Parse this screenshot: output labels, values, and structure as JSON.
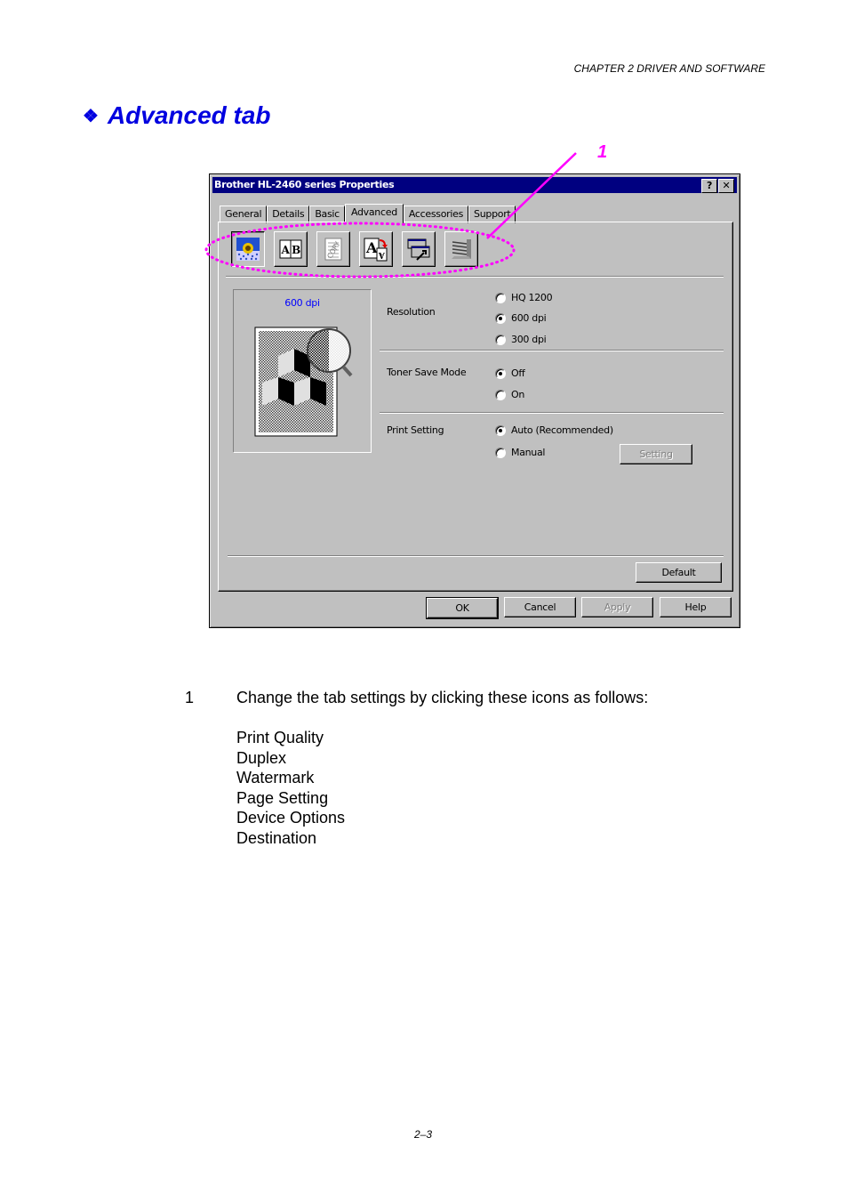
{
  "page": {
    "header": "CHAPTER 2 DRIVER AND SOFTWARE",
    "title_bullet": "❖",
    "title": "Advanced tab",
    "callout_label": "1",
    "footer": "2–3",
    "colors": {
      "title": "#0000e0",
      "callout": "#ff00ff",
      "titlebar": "#000080",
      "dialog_bg": "#c0c0c0"
    }
  },
  "dialog": {
    "title": "Brother HL-2460 series Properties",
    "help_button": "?",
    "close_button": "✕",
    "tabs": [
      {
        "label": "General",
        "active": false
      },
      {
        "label": "Details",
        "active": false
      },
      {
        "label": "Basic",
        "active": false
      },
      {
        "label": "Advanced",
        "active": true
      },
      {
        "label": "Accessories",
        "active": false
      },
      {
        "label": "Support",
        "active": false
      }
    ],
    "icons": [
      {
        "name": "print-quality-icon",
        "pressed": true
      },
      {
        "name": "duplex-icon",
        "pressed": false
      },
      {
        "name": "watermark-icon",
        "pressed": false
      },
      {
        "name": "page-setting-icon",
        "pressed": false
      },
      {
        "name": "device-options-icon",
        "pressed": false
      },
      {
        "name": "destination-icon",
        "pressed": false
      }
    ],
    "preview_label": "600 dpi",
    "resolution": {
      "label": "Resolution",
      "options": [
        {
          "label": "HQ 1200",
          "selected": false
        },
        {
          "label": "600 dpi",
          "selected": true
        },
        {
          "label": "300 dpi",
          "selected": false
        }
      ]
    },
    "toner_save": {
      "label": "Toner Save Mode",
      "options": [
        {
          "label": "Off",
          "selected": true
        },
        {
          "label": "On",
          "selected": false
        }
      ]
    },
    "print_setting": {
      "label": "Print Setting",
      "options": [
        {
          "label": "Auto (Recommended)",
          "selected": true
        },
        {
          "label": "Manual",
          "selected": false
        }
      ],
      "setting_button": "Setting"
    },
    "default_button": "Default",
    "buttons": {
      "ok": "OK",
      "cancel": "Cancel",
      "apply": "Apply",
      "help": "Help"
    }
  },
  "body": {
    "item_number": "1",
    "instruction": "Change the tab settings by clicking these icons as follows:",
    "icon_list": [
      "Print Quality",
      "Duplex",
      "Watermark",
      "Page Setting",
      "Device Options",
      "Destination"
    ]
  }
}
